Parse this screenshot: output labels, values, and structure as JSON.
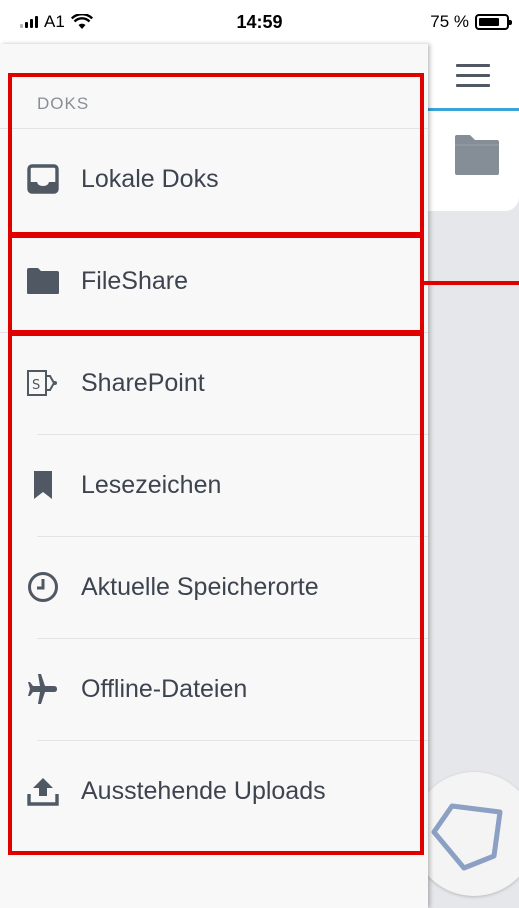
{
  "status_bar": {
    "carrier": "A1",
    "time": "14:59",
    "battery": "75 %"
  },
  "drawer": {
    "section_title": "DOKS",
    "items": [
      {
        "label": "Lokale Doks",
        "icon": "inbox-icon"
      },
      {
        "label": "FileShare",
        "icon": "folder-icon"
      },
      {
        "label": "SharePoint",
        "icon": "sharepoint-icon"
      },
      {
        "label": "Lesezeichen",
        "icon": "bookmark-icon"
      },
      {
        "label": "Aktuelle Speicherorte",
        "icon": "clock-icon"
      },
      {
        "label": "Offline-Dateien",
        "icon": "airplane-icon"
      },
      {
        "label": "Ausstehende Uploads",
        "icon": "upload-icon"
      }
    ]
  },
  "colors": {
    "annotation": "#e00000",
    "accent": "#3aa3da",
    "icon": "#505864"
  }
}
